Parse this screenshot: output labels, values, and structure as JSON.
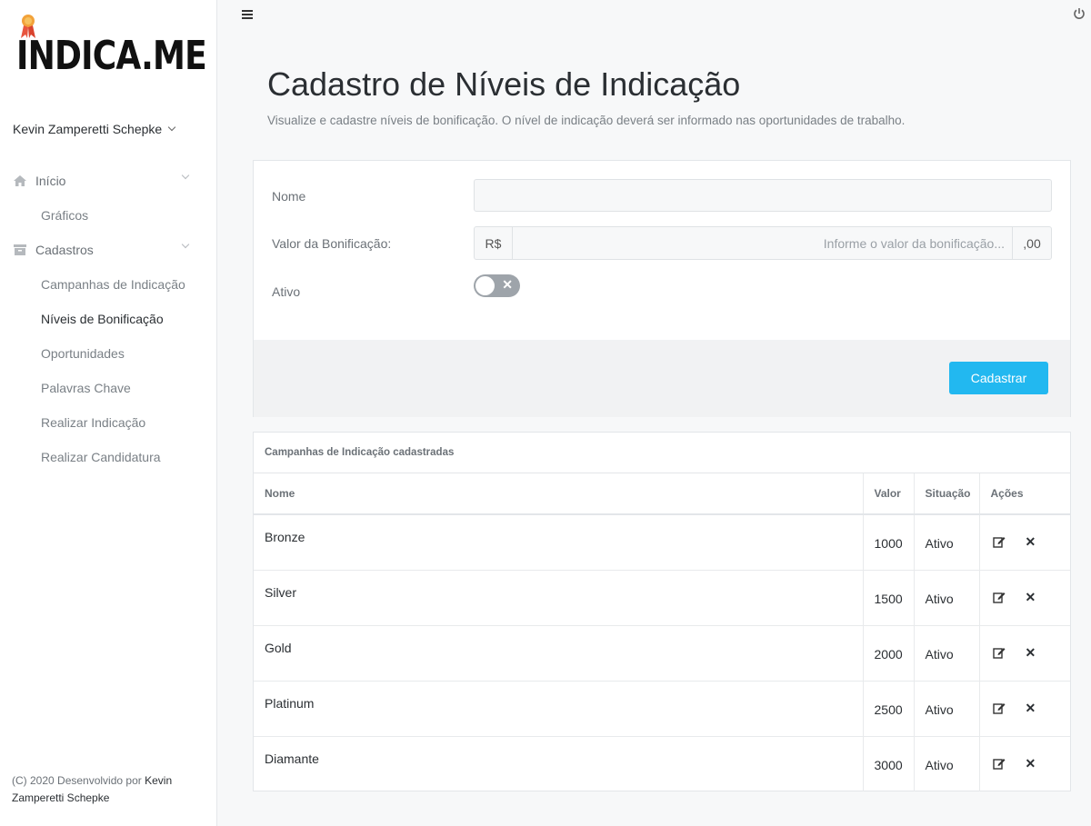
{
  "brand": {
    "logo_text": "INDICA.ME"
  },
  "user": {
    "name": "Kevin Zamperetti Schepke"
  },
  "sidebar": {
    "groups": [
      {
        "label": "Início",
        "items": [
          {
            "label": "Gráficos"
          }
        ]
      },
      {
        "label": "Cadastros",
        "items": [
          {
            "label": "Campanhas de Indicação"
          },
          {
            "label": "Níveis de Bonificação"
          },
          {
            "label": "Oportunidades"
          },
          {
            "label": "Palavras Chave"
          },
          {
            "label": "Realizar Indicação"
          },
          {
            "label": "Realizar Candidatura"
          }
        ]
      }
    ]
  },
  "footer": {
    "prefix": "(C) 2020 Desenvolvido por",
    "author": "Kevin Zamperetti Schepke"
  },
  "header": {
    "title": "Cadastro de Níveis de Indicação",
    "subtitle": "Visualize e cadastre níveis de bonificação. O nível de indicação deverá ser informado nas oportunidades de trabalho."
  },
  "form": {
    "nome_label": "Nome",
    "nome_value": "",
    "valor_label": "Valor da Bonificação:",
    "valor_prefix": "R$",
    "valor_placeholder": "Informe o valor da bonificação...",
    "valor_suffix": ",00",
    "ativo_label": "Ativo",
    "ativo_on": false,
    "submit_label": "Cadastrar"
  },
  "table": {
    "caption": "Campanhas de Indicação cadastradas",
    "headers": {
      "nome": "Nome",
      "valor": "Valor",
      "situacao": "Situação",
      "acoes": "Ações"
    },
    "rows": [
      {
        "nome": "Bronze",
        "valor": "1000",
        "situacao": "Ativo"
      },
      {
        "nome": "Silver",
        "valor": "1500",
        "situacao": "Ativo"
      },
      {
        "nome": "Gold",
        "valor": "2000",
        "situacao": "Ativo"
      },
      {
        "nome": "Platinum",
        "valor": "2500",
        "situacao": "Ativo"
      },
      {
        "nome": "Diamante",
        "valor": "3000",
        "situacao": "Ativo"
      }
    ]
  },
  "icons": {
    "menu": "hamburger-icon",
    "power": "power-icon",
    "home": "home-icon",
    "cadastros": "archive-icon",
    "edit": "edit-icon",
    "delete": "close-icon",
    "medal": "medal-icon"
  },
  "colors": {
    "accent": "#22b8f0",
    "toggle_off": "#9ea4aa",
    "medal": "#e8553f"
  }
}
